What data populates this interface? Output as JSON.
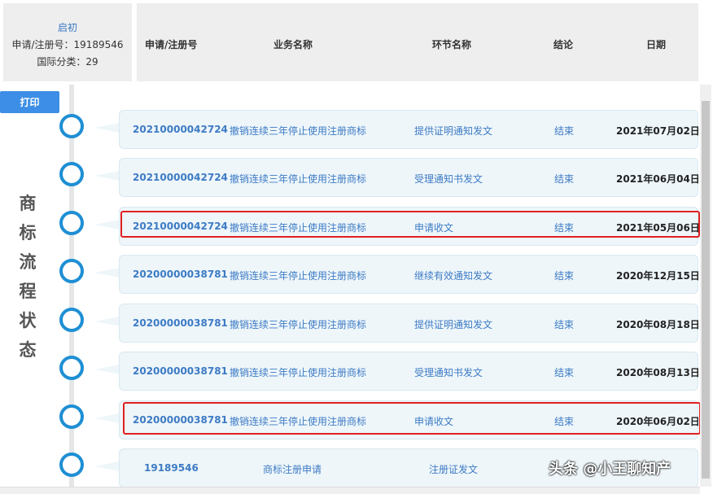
{
  "info": {
    "status": "启初",
    "reg_number": "申请/注册号：19189546",
    "intl_class": "国际分类：29"
  },
  "header": {
    "col_number": "申请/注册号",
    "col_business": "业务名称",
    "col_stage": "环节名称",
    "col_result": "结论",
    "col_date": "日期"
  },
  "print_label": "打印",
  "vertical_title": [
    "商",
    "标",
    "流",
    "程",
    "状",
    "态"
  ],
  "rows": [
    {
      "number": "20210000042724",
      "business": "撤销连续三年停止使用注册商标",
      "stage": "提供证明通知发文",
      "result": "结束",
      "date": "2021年07月02日"
    },
    {
      "number": "20210000042724",
      "business": "撤销连续三年停止使用注册商标",
      "stage": "受理通知书发文",
      "result": "结束",
      "date": "2021年06月04日"
    },
    {
      "number": "20210000042724",
      "business": "撤销连续三年停止使用注册商标",
      "stage": "申请收文",
      "result": "结束",
      "date": "2021年05月06日"
    },
    {
      "number": "20200000038781",
      "business": "撤销连续三年停止使用注册商标",
      "stage": "继续有效通知发文",
      "result": "结束",
      "date": "2020年12月15日"
    },
    {
      "number": "20200000038781",
      "business": "撤销连续三年停止使用注册商标",
      "stage": "提供证明通知发文",
      "result": "结束",
      "date": "2020年08月18日"
    },
    {
      "number": "20200000038781",
      "business": "撤销连续三年停止使用注册商标",
      "stage": "受理通知书发文",
      "result": "结束",
      "date": "2020年08月13日"
    },
    {
      "number": "20200000038781",
      "business": "撤销连续三年停止使用注册商标",
      "stage": "申请收文",
      "result": "结束",
      "date": "2020年06月02日"
    },
    {
      "number": "19189546",
      "business": "商标注册申请",
      "stage": "注册证发文",
      "result": "",
      "date": ""
    }
  ],
  "watermark": "头条 @小王聊知产",
  "colors": {
    "accent": "#1e8fd4",
    "link": "#3d7bc4",
    "highlight": "#e02020",
    "button": "#3c8ee6"
  }
}
